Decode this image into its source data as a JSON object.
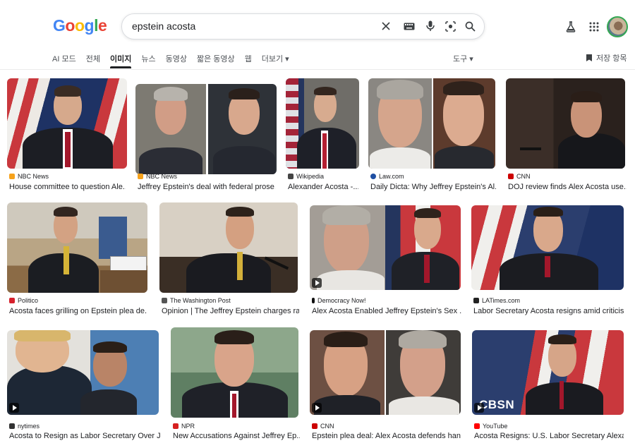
{
  "search": {
    "query": "epstein acosta"
  },
  "logo": {
    "letters": [
      "G",
      "o",
      "o",
      "g",
      "l",
      "e"
    ],
    "colors": [
      "#4285F4",
      "#EA4335",
      "#FBBC05",
      "#4285F4",
      "#34A853",
      "#EA4335"
    ]
  },
  "tabs": [
    {
      "label": "AI 모드",
      "active": false
    },
    {
      "label": "전체",
      "active": false
    },
    {
      "label": "이미지",
      "active": true
    },
    {
      "label": "뉴스",
      "active": false
    },
    {
      "label": "동영상",
      "active": false
    },
    {
      "label": "짧은 동영상",
      "active": false
    },
    {
      "label": "웹",
      "active": false
    },
    {
      "label": "더보기 ▾",
      "active": false
    }
  ],
  "tools_label": "도구 ▾",
  "saved_label": "저장 항목",
  "results": [
    {
      "source": "NBC News",
      "title": "House committee to question Ale...",
      "video": false,
      "fav": "#f6a21c"
    },
    {
      "source": "NBC News",
      "title": "Jeffrey Epstein's deal with federal prose...",
      "video": false,
      "fav": "#f6a21c"
    },
    {
      "source": "Wikipedia",
      "title": "Alexander Acosta -...",
      "video": false,
      "fav": "#444444"
    },
    {
      "source": "Law.com",
      "title": "Daily Dicta: Why Jeffrey Epstein's Al...",
      "video": false,
      "fav": "#1f4fa3"
    },
    {
      "source": "CNN",
      "title": "DOJ review finds Alex Acosta use...",
      "video": false,
      "fav": "#cc0000"
    },
    {
      "source": "Politico",
      "title": "Acosta faces grilling on Epstein plea de...",
      "video": false,
      "fav": "#d6202c"
    },
    {
      "source": "The Washington Post",
      "title": "Opinion | The Jeffrey Epstein charges ra...",
      "video": false,
      "fav": "#555555"
    },
    {
      "source": "Democracy Now!",
      "title": "Alex Acosta Enabled Jeffrey Epstein's Sex ...",
      "video": true,
      "fav": "#111111"
    },
    {
      "source": "LATimes.com",
      "title": "Labor Secretary Acosta resigns amid criticis...",
      "video": false,
      "fav": "#222222"
    },
    {
      "source": "nytimes",
      "title": "Acosta to Resign as Labor Secretary Over J...",
      "video": true,
      "fav": "#333333"
    },
    {
      "source": "NPR",
      "title": "New Accusations Against Jeffrey Ep...",
      "video": false,
      "fav": "#d62021"
    },
    {
      "source": "CNN",
      "title": "Epstein plea deal: Alex Acosta defends han...",
      "video": true,
      "fav": "#cc0000"
    },
    {
      "source": "YouTube",
      "title": "Acosta Resigns: U.S. Labor Secretary Alexa...",
      "video": true,
      "fav": "#ff0000",
      "overlay": "CBSN"
    }
  ]
}
